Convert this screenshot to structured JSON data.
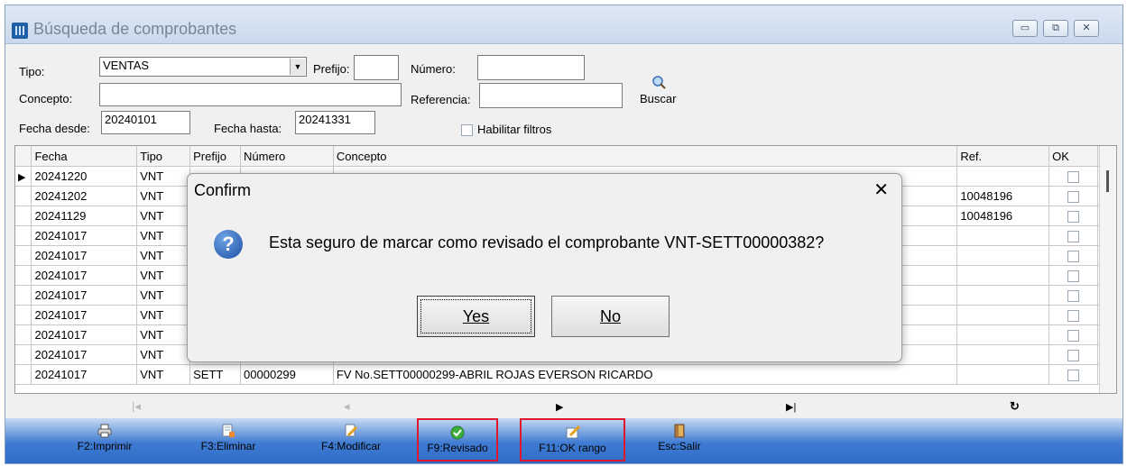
{
  "window": {
    "title": "Búsqueda de comprobantes",
    "minimize": "▭",
    "restore": "⧉",
    "close": "✕"
  },
  "filters": {
    "tipo_label": "Tipo:",
    "tipo_value": "VENTAS",
    "prefijo_label": "Prefijo:",
    "prefijo_value": "",
    "numero_label": "Número:",
    "numero_value": "",
    "concepto_label": "Concepto:",
    "concepto_value": "",
    "referencia_label": "Referencia:",
    "referencia_value": "",
    "buscar_label": "Buscar",
    "fecha_desde_label": "Fecha desde:",
    "fecha_desde_value": "20240101",
    "fecha_hasta_label": "Fecha hasta:",
    "fecha_hasta_value": "20241331",
    "habilitar_label": "Habilitar filtros"
  },
  "grid": {
    "columns": [
      "Fecha",
      "Tipo",
      "Prefijo",
      "Número",
      "Concepto",
      "Ref.",
      "OK"
    ],
    "rows": [
      {
        "fecha": "20241220",
        "tipo": "VNT",
        "prefijo": "",
        "numero": "",
        "concepto": "",
        "ref": ""
      },
      {
        "fecha": "20241202",
        "tipo": "VNT",
        "prefijo": "",
        "numero": "",
        "concepto": "",
        "ref": "10048196"
      },
      {
        "fecha": "20241129",
        "tipo": "VNT",
        "prefijo": "",
        "numero": "",
        "concepto": "",
        "ref": "10048196"
      },
      {
        "fecha": "20241017",
        "tipo": "VNT",
        "prefijo": "",
        "numero": "",
        "concepto": "",
        "ref": ""
      },
      {
        "fecha": "20241017",
        "tipo": "VNT",
        "prefijo": "",
        "numero": "",
        "concepto": "",
        "ref": ""
      },
      {
        "fecha": "20241017",
        "tipo": "VNT",
        "prefijo": "",
        "numero": "",
        "concepto": "",
        "ref": ""
      },
      {
        "fecha": "20241017",
        "tipo": "VNT",
        "prefijo": "",
        "numero": "",
        "concepto": "",
        "ref": ""
      },
      {
        "fecha": "20241017",
        "tipo": "VNT",
        "prefijo": "",
        "numero": "",
        "concepto": "",
        "ref": ""
      },
      {
        "fecha": "20241017",
        "tipo": "VNT",
        "prefijo": "",
        "numero": "",
        "concepto": "",
        "ref": ""
      },
      {
        "fecha": "20241017",
        "tipo": "VNT",
        "prefijo": "",
        "numero": "",
        "concepto": "",
        "ref": ""
      },
      {
        "fecha": "20241017",
        "tipo": "VNT",
        "prefijo": "SETT",
        "numero": "00000299",
        "concepto": "FV No.SETT00000299-ABRIL ROJAS EVERSON RICARDO",
        "ref": ""
      }
    ]
  },
  "nav": {
    "first": "|◂",
    "prev": "◂",
    "next": "▶",
    "last": "▶|",
    "refresh": "↻"
  },
  "toolbar": [
    {
      "label": "F2:Imprimir",
      "icon": "printer-icon"
    },
    {
      "label": "F3:Eliminar",
      "icon": "delete-doc-icon"
    },
    {
      "label": "F4:Modificar",
      "icon": "edit-doc-icon"
    },
    {
      "label": "F9:Revisado",
      "icon": "check-icon"
    },
    {
      "label": "F11:OK rango",
      "icon": "pencil-note-icon"
    },
    {
      "label": "Esc:Salir",
      "icon": "door-icon"
    }
  ],
  "dialog": {
    "title": "Confirm",
    "close": "✕",
    "message": "Esta seguro de marcar como revisado el comprobante VNT-SETT00000382?",
    "yes_label": "Yes",
    "no_label": "No"
  },
  "colors": {
    "highlight": "#e0162b",
    "toolbar": "#3f7bd2"
  }
}
